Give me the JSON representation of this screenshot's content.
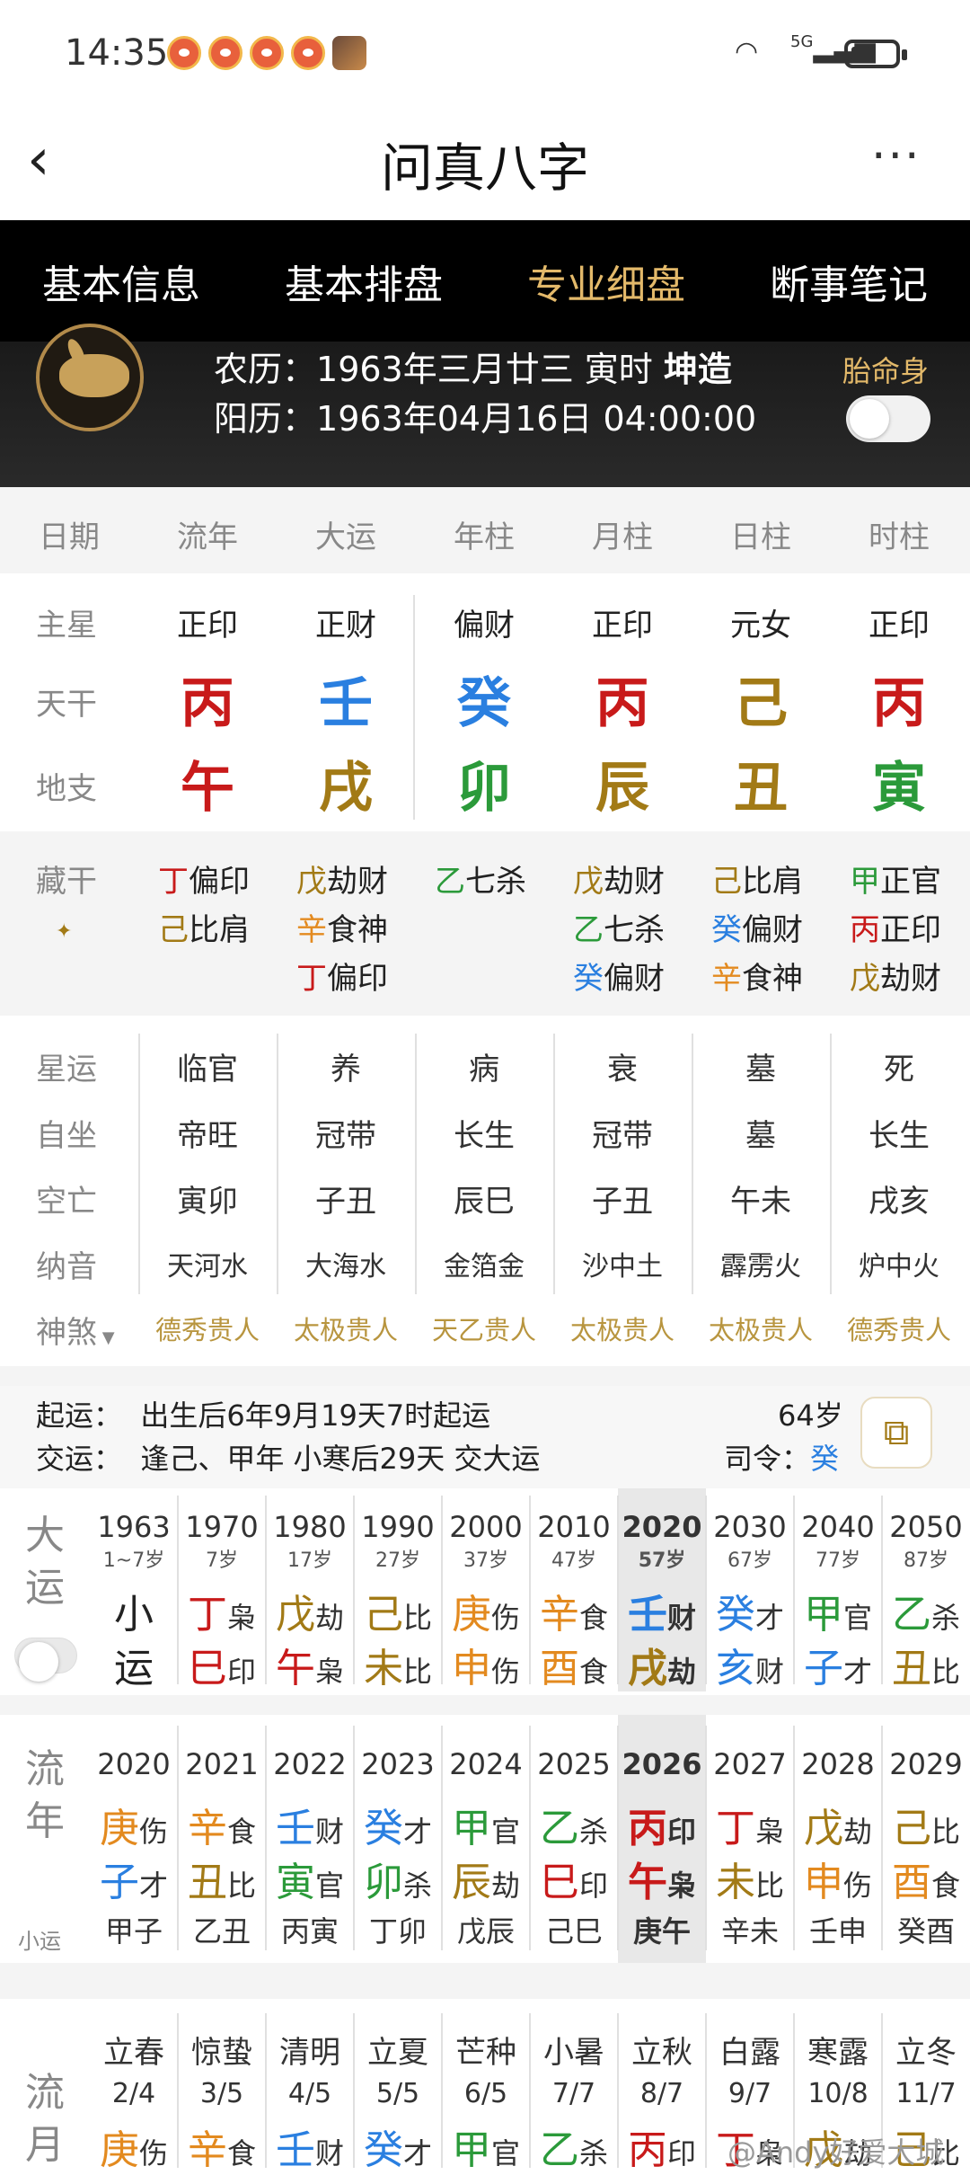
{
  "status_bar": {
    "time": "14:35",
    "network": "5G"
  },
  "title_bar": {
    "title": "问真八字",
    "more": "···"
  },
  "tabs": [
    "基本信息",
    "基本排盘",
    "专业细盘",
    "断事笔记"
  ],
  "profile": {
    "lunar_prefix": "农历：",
    "lunar": "1963年三月廿三 寅时",
    "gender": "坤造",
    "solar_prefix": "阳历：",
    "solar": "1963年04月16日 04:00:00",
    "tms_label": "胎命身"
  },
  "columns": [
    "日期",
    "流年",
    "大运",
    "年柱",
    "月柱",
    "日柱",
    "时柱"
  ],
  "main_star": {
    "label": "主星",
    "values": [
      "正印",
      "正财",
      "偏财",
      "正印",
      "元女",
      "正印"
    ]
  },
  "tian_gan": {
    "label": "天干",
    "values": [
      "丙",
      "壬",
      "癸",
      "丙",
      "己",
      "丙"
    ],
    "colors": [
      "red",
      "blue",
      "blue",
      "red",
      "gold",
      "red"
    ]
  },
  "di_zhi": {
    "label": "地支",
    "values": [
      "午",
      "戌",
      "卯",
      "辰",
      "丑",
      "寅"
    ],
    "colors": [
      "red",
      "gold",
      "green",
      "gold",
      "gold",
      "green"
    ]
  },
  "cang_gan": {
    "label": "藏干",
    "cols": [
      [
        {
          "g": "丁",
          "t": "偏印",
          "c": "red"
        },
        {
          "g": "己",
          "t": "比肩",
          "c": "gold"
        }
      ],
      [
        {
          "g": "戊",
          "t": "劫财",
          "c": "gold"
        },
        {
          "g": "辛",
          "t": "食神",
          "c": "orange"
        },
        {
          "g": "丁",
          "t": "偏印",
          "c": "red"
        }
      ],
      [
        {
          "g": "乙",
          "t": "七杀",
          "c": "green"
        }
      ],
      [
        {
          "g": "戊",
          "t": "劫财",
          "c": "gold"
        },
        {
          "g": "乙",
          "t": "七杀",
          "c": "green"
        },
        {
          "g": "癸",
          "t": "偏财",
          "c": "blue"
        }
      ],
      [
        {
          "g": "己",
          "t": "比肩",
          "c": "gold"
        },
        {
          "g": "癸",
          "t": "偏财",
          "c": "blue"
        },
        {
          "g": "辛",
          "t": "食神",
          "c": "orange"
        }
      ],
      [
        {
          "g": "甲",
          "t": "正官",
          "c": "green"
        },
        {
          "g": "丙",
          "t": "正印",
          "c": "red"
        },
        {
          "g": "戊",
          "t": "劫财",
          "c": "gold"
        }
      ]
    ]
  },
  "xing_yun": {
    "label": "星运",
    "values": [
      "临官",
      "养",
      "病",
      "衰",
      "墓",
      "死"
    ]
  },
  "zi_zuo": {
    "label": "自坐",
    "values": [
      "帝旺",
      "冠带",
      "长生",
      "冠带",
      "墓",
      "长生"
    ]
  },
  "kong_wang": {
    "label": "空亡",
    "values": [
      "寅卯",
      "子丑",
      "辰巳",
      "子丑",
      "午未",
      "戌亥"
    ]
  },
  "na_yin": {
    "label": "纳音",
    "values": [
      "天河水",
      "大海水",
      "金箔金",
      "沙中土",
      "霹雳火",
      "炉中火"
    ]
  },
  "shen_sha": {
    "label": "神煞",
    "values": [
      "德秀贵人",
      "太极贵人",
      "天乙贵人",
      "太极贵人",
      "太极贵人",
      "德秀贵人"
    ]
  },
  "qi_yun": {
    "label": "起运：",
    "text": "出生后6年9月19天7时起运",
    "age": "64岁"
  },
  "jiao_yun": {
    "label": "交运：",
    "text": "逢己、甲年 小寒后29天 交大运",
    "si_ling_label": "司令：",
    "si_ling": "癸"
  },
  "da_yun": {
    "label": "大运",
    "items": [
      {
        "y": "1963",
        "a": "1~7岁",
        "g": "小",
        "gt": "",
        "z": "运",
        "zt": "",
        "gc": "",
        "zc": ""
      },
      {
        "y": "1970",
        "a": "7岁",
        "g": "丁",
        "gt": "枭",
        "z": "巳",
        "zt": "印",
        "gc": "red",
        "zc": "red"
      },
      {
        "y": "1980",
        "a": "17岁",
        "g": "戊",
        "gt": "劫",
        "z": "午",
        "zt": "枭",
        "gc": "gold",
        "zc": "red"
      },
      {
        "y": "1990",
        "a": "27岁",
        "g": "己",
        "gt": "比",
        "z": "未",
        "zt": "比",
        "gc": "gold",
        "zc": "gold"
      },
      {
        "y": "2000",
        "a": "37岁",
        "g": "庚",
        "gt": "伤",
        "z": "申",
        "zt": "伤",
        "gc": "orange",
        "zc": "orange"
      },
      {
        "y": "2010",
        "a": "47岁",
        "g": "辛",
        "gt": "食",
        "z": "酉",
        "zt": "食",
        "gc": "orange",
        "zc": "orange"
      },
      {
        "y": "2020",
        "a": "57岁",
        "g": "壬",
        "gt": "财",
        "z": "戌",
        "zt": "劫",
        "gc": "blue",
        "zc": "gold"
      },
      {
        "y": "2030",
        "a": "67岁",
        "g": "癸",
        "gt": "才",
        "z": "亥",
        "zt": "财",
        "gc": "blue",
        "zc": "blue"
      },
      {
        "y": "2040",
        "a": "77岁",
        "g": "甲",
        "gt": "官",
        "z": "子",
        "zt": "才",
        "gc": "green",
        "zc": "blue"
      },
      {
        "y": "2050",
        "a": "87岁",
        "g": "乙",
        "gt": "杀",
        "z": "丑",
        "zt": "比",
        "gc": "green",
        "zc": "gold"
      }
    ]
  },
  "liu_nian": {
    "label": "流年",
    "sub": "小运",
    "items": [
      {
        "y": "2020",
        "g": "庚",
        "gt": "伤",
        "z": "子",
        "zt": "才",
        "gc": "orange",
        "zc": "blue",
        "x": "甲子"
      },
      {
        "y": "2021",
        "g": "辛",
        "gt": "食",
        "z": "丑",
        "zt": "比",
        "gc": "orange",
        "zc": "gold",
        "x": "乙丑"
      },
      {
        "y": "2022",
        "g": "壬",
        "gt": "财",
        "z": "寅",
        "zt": "官",
        "gc": "blue",
        "zc": "green",
        "x": "丙寅"
      },
      {
        "y": "2023",
        "g": "癸",
        "gt": "才",
        "z": "卯",
        "zt": "杀",
        "gc": "blue",
        "zc": "green",
        "x": "丁卯"
      },
      {
        "y": "2024",
        "g": "甲",
        "gt": "官",
        "z": "辰",
        "zt": "劫",
        "gc": "green",
        "zc": "gold",
        "x": "戊辰"
      },
      {
        "y": "2025",
        "g": "乙",
        "gt": "杀",
        "z": "巳",
        "zt": "印",
        "gc": "green",
        "zc": "red",
        "x": "己巳"
      },
      {
        "y": "2026",
        "g": "丙",
        "gt": "印",
        "z": "午",
        "zt": "枭",
        "gc": "red",
        "zc": "red",
        "x": "庚午"
      },
      {
        "y": "2027",
        "g": "丁",
        "gt": "枭",
        "z": "未",
        "zt": "比",
        "gc": "red",
        "zc": "gold",
        "x": "辛未"
      },
      {
        "y": "2028",
        "g": "戊",
        "gt": "劫",
        "z": "申",
        "zt": "伤",
        "gc": "gold",
        "zc": "orange",
        "x": "壬申"
      },
      {
        "y": "2029",
        "g": "己",
        "gt": "比",
        "z": "酉",
        "zt": "食",
        "gc": "gold",
        "zc": "orange",
        "x": "癸酉"
      }
    ]
  },
  "liu_yue": {
    "label": "流月",
    "items": [
      {
        "jq": "立春",
        "d": "2/4",
        "g": "庚",
        "gt": "伤",
        "gc": "orange"
      },
      {
        "jq": "惊蛰",
        "d": "3/5",
        "g": "辛",
        "gt": "食",
        "gc": "orange"
      },
      {
        "jq": "清明",
        "d": "4/5",
        "g": "壬",
        "gt": "财",
        "gc": "blue"
      },
      {
        "jq": "立夏",
        "d": "5/5",
        "g": "癸",
        "gt": "才",
        "gc": "blue"
      },
      {
        "jq": "芒种",
        "d": "6/5",
        "g": "甲",
        "gt": "官",
        "gc": "green"
      },
      {
        "jq": "小暑",
        "d": "7/7",
        "g": "乙",
        "gt": "杀",
        "gc": "green"
      },
      {
        "jq": "立秋",
        "d": "8/7",
        "g": "丙",
        "gt": "印",
        "gc": "red"
      },
      {
        "jq": "白露",
        "d": "9/7",
        "g": "丁",
        "gt": "枭",
        "gc": "red"
      },
      {
        "jq": "寒露",
        "d": "10/8",
        "g": "戊",
        "gt": "劫",
        "gc": "gold"
      },
      {
        "jq": "立冬",
        "d": "11/7",
        "g": "己",
        "gt": "比",
        "gc": "gold"
      }
    ]
  },
  "watermark": "@Andy好爱大城"
}
